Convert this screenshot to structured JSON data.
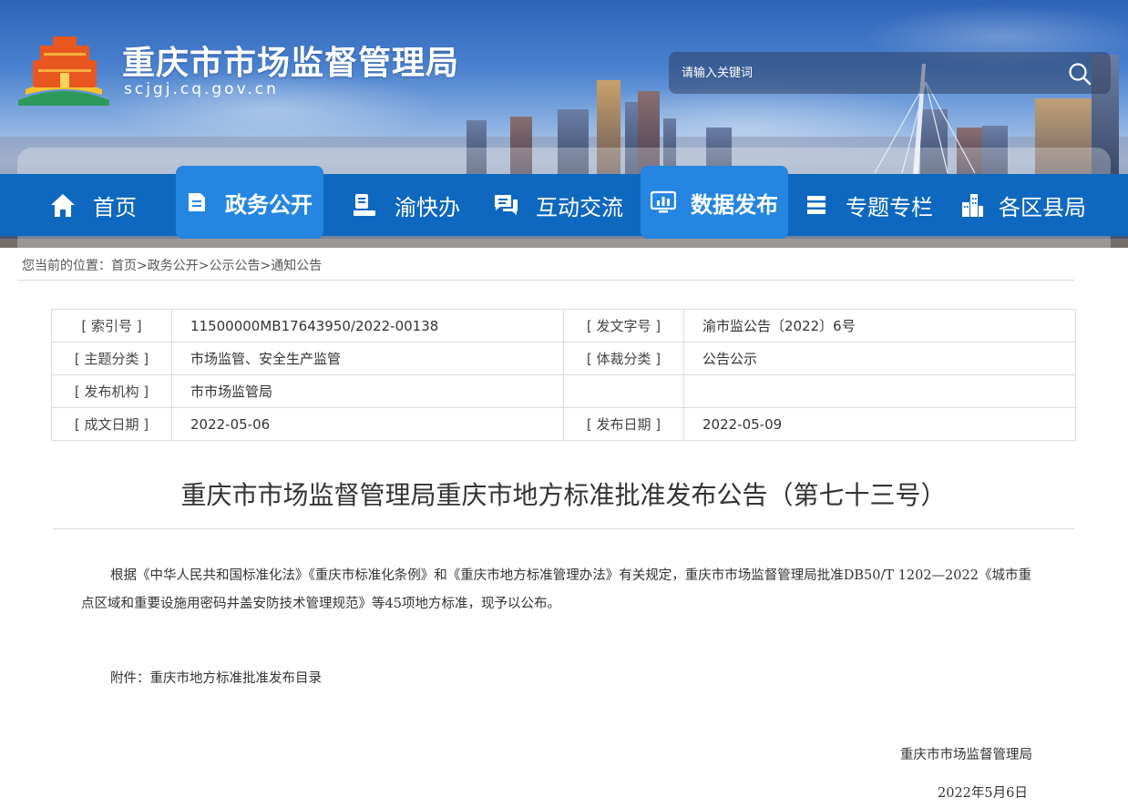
{
  "header": {
    "site_title": "重庆市市场监督管理局",
    "domain": "scjgj.cq.gov.cn",
    "logo_icon": "tiered-building-logo-icon"
  },
  "search": {
    "placeholder": "请输入关键词",
    "icon": "search-icon"
  },
  "nav": {
    "items": [
      {
        "label": "首页",
        "icon": "home-icon",
        "active": false
      },
      {
        "label": "政务公开",
        "icon": "document-icon",
        "active": true
      },
      {
        "label": "渝快办",
        "icon": "stamp-icon",
        "active": false
      },
      {
        "label": "互动交流",
        "icon": "chat-icon",
        "active": false
      },
      {
        "label": "数据发布",
        "icon": "bar-chart-icon",
        "active": true
      },
      {
        "label": "专题专栏",
        "icon": "stack-icon",
        "active": false
      },
      {
        "label": "各区县局",
        "icon": "city-icon",
        "active": false
      }
    ]
  },
  "breadcrumb": {
    "prefix": "您当前的位置：",
    "items": [
      "首页",
      "政务公开",
      "公示公告",
      "通知公告"
    ],
    "separator": ">"
  },
  "info_table": {
    "index_label": "[ 索引号 ]",
    "index_value": "11500000MB17643950/2022-00138",
    "doc_no_label": "[ 发文字号 ]",
    "doc_no_value": "渝市监公告〔2022〕6号",
    "topic_label": "[ 主题分类 ]",
    "topic_value": "市场监管、安全生产监管",
    "genre_label": "[ 体裁分类 ]",
    "genre_value": "公告公示",
    "issuer_label": "[ 发布机构 ]",
    "issuer_value": "市市场监管局",
    "written_label": "[ 成文日期 ]",
    "written_value": "2022-05-06",
    "published_label": "[ 发布日期 ]",
    "published_value": "2022-05-09"
  },
  "article": {
    "title": "重庆市市场监督管理局重庆市地方标准批准发布公告（第七十三号）",
    "body": "根据《中华人民共和国标准化法》《重庆市标准化条例》和《重庆市地方标准管理办法》有关规定，重庆市市场监督管理局批准DB50/T 1202—2022《城市重点区域和重要设施用密码井盖安防技术管理规范》等45项地方标准，现予以公布。",
    "attachment": "附件：重庆市地方标准批准发布目录",
    "signature_org": "重庆市市场监督管理局",
    "signature_date": "2022年5月6日"
  },
  "colors": {
    "nav_bar": "#0f68bf",
    "nav_active": "#2486e0"
  }
}
